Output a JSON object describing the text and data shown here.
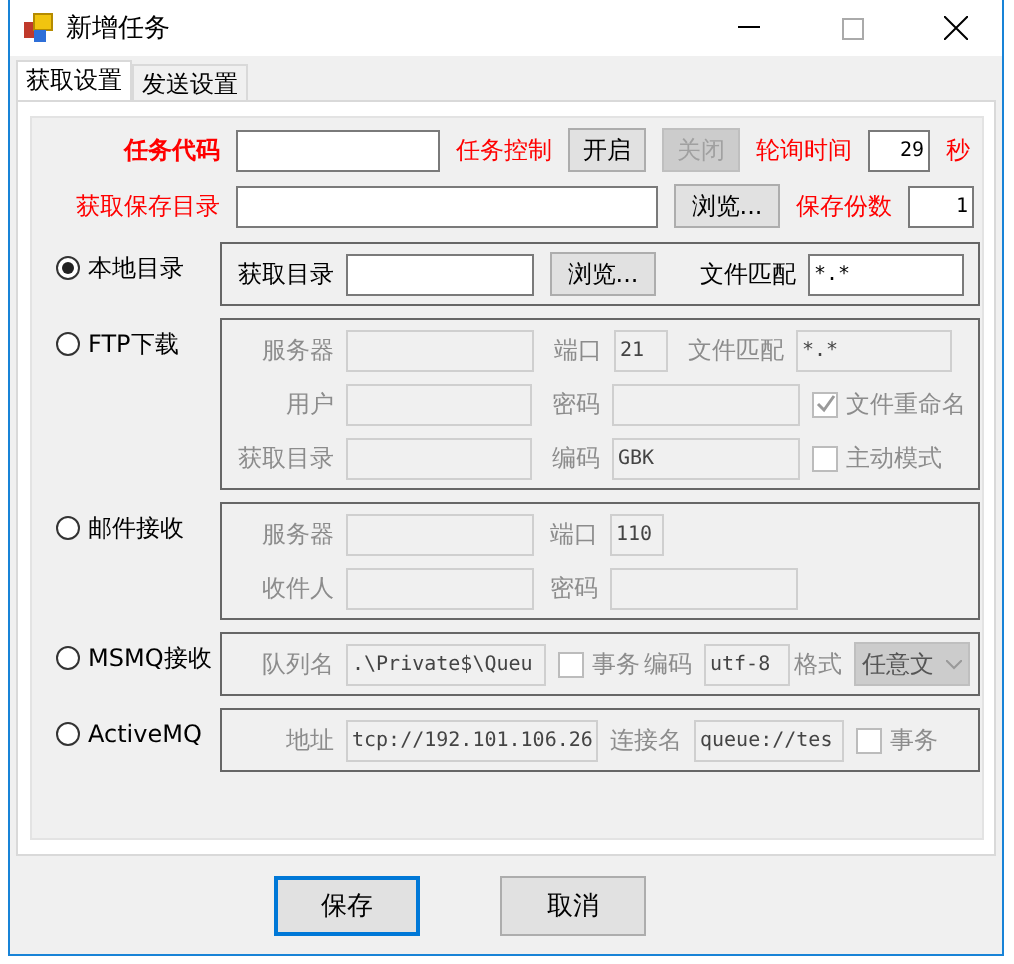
{
  "window": {
    "title": "新增任务"
  },
  "tabs": [
    {
      "label": "获取设置",
      "selected": true
    },
    {
      "label": "发送设置",
      "selected": false
    }
  ],
  "task": {
    "code_label": "任务代码",
    "control_label": "任务控制",
    "start_button": {
      "label": "开启",
      "disabled": false
    },
    "stop_button": {
      "label": "关闭",
      "disabled": true
    },
    "poll_label": "轮询时间",
    "poll_value": "29",
    "poll_unit": "秒",
    "save_dir_label": "获取保存目录",
    "browse_button": "浏览...",
    "copies_label": "保存份数",
    "copies_value": "1"
  },
  "sources": [
    {
      "label": "本地目录",
      "selected": true,
      "rows": [
        [
          {
            "kind": "field",
            "label": "获取目录"
          },
          {
            "kind": "button",
            "label": "浏览..."
          },
          {
            "kind": "field",
            "label": "文件匹配",
            "value": "*.*"
          }
        ]
      ]
    },
    {
      "label": "FTP下载",
      "selected": false,
      "rows": [
        [
          {
            "kind": "field",
            "label": "服务器"
          },
          {
            "kind": "field",
            "label": "端口",
            "value": "21"
          },
          {
            "kind": "field",
            "label": "文件匹配",
            "value": "*.*"
          }
        ],
        [
          {
            "kind": "field",
            "label": "用户"
          },
          {
            "kind": "field",
            "label": "密码"
          },
          {
            "kind": "checkbox",
            "label": "文件重命名",
            "checked": true
          }
        ],
        [
          {
            "kind": "field",
            "label": "获取目录"
          },
          {
            "kind": "field",
            "label": "编码",
            "value": "GBK"
          },
          {
            "kind": "checkbox",
            "label": "主动模式",
            "checked": false
          }
        ]
      ]
    },
    {
      "label": "邮件接收",
      "selected": false,
      "rows": [
        [
          {
            "kind": "field",
            "label": "服务器"
          },
          {
            "kind": "field",
            "label": "端口",
            "value": "110"
          }
        ],
        [
          {
            "kind": "field",
            "label": "收件人"
          },
          {
            "kind": "field",
            "label": "密码"
          }
        ]
      ]
    },
    {
      "label": "MSMQ接收",
      "selected": false,
      "rows": [
        [
          {
            "kind": "field",
            "label": "队列名",
            "value": ".\\Private$\\Queu"
          },
          {
            "kind": "checkbox",
            "label": "事务",
            "checked": false
          },
          {
            "kind": "field",
            "label": "编码",
            "value": "utf-8"
          },
          {
            "kind": "select",
            "label": "格式",
            "value": "任意文"
          }
        ]
      ]
    },
    {
      "label": "ActiveMQ",
      "selected": false,
      "rows": [
        [
          {
            "kind": "field",
            "label": "地址",
            "value": "tcp://192.101.106.26"
          },
          {
            "kind": "field",
            "label": "连接名",
            "value": "queue://tes"
          },
          {
            "kind": "checkbox",
            "label": "事务",
            "checked": false
          }
        ]
      ]
    }
  ],
  "buttons": [
    {
      "label": "保存",
      "default": true
    },
    {
      "label": "取消",
      "default": false
    }
  ]
}
